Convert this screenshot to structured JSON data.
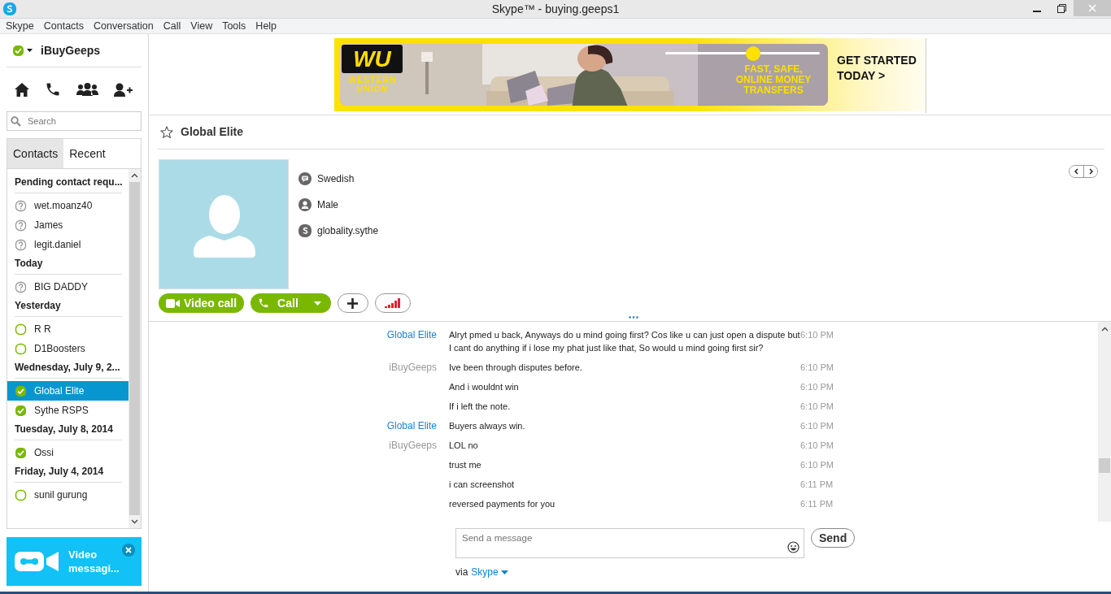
{
  "window": {
    "title": "Skype™ - buying.geeps1"
  },
  "menu": [
    "Skype",
    "Contacts",
    "Conversation",
    "Call",
    "View",
    "Tools",
    "Help"
  ],
  "profile": {
    "name": "iBuyGeeps",
    "kind": "online"
  },
  "search": {
    "placeholder": "Search"
  },
  "tabs": [
    {
      "label": "Contacts",
      "selected": true
    },
    {
      "label": "Recent",
      "selected": false
    }
  ],
  "contact_groups": [
    {
      "header": "Pending contact requ...",
      "contacts": [
        {
          "name": "wet.moanz40",
          "kind": "pending",
          "selected": false
        },
        {
          "name": "James",
          "kind": "pending",
          "selected": false
        },
        {
          "name": "legit.daniel",
          "kind": "pending",
          "selected": false
        }
      ]
    },
    {
      "header": "Today",
      "contacts": [
        {
          "name": "BIG DADDY",
          "kind": "pending",
          "selected": false
        }
      ]
    },
    {
      "header": "Yesterday",
      "contacts": [
        {
          "name": "R R",
          "kind": "offline",
          "selected": false
        },
        {
          "name": "D1Boosters",
          "kind": "offline",
          "selected": false
        }
      ]
    },
    {
      "header": "Wednesday, July 9, 2...",
      "contacts": [
        {
          "name": "Global Elite",
          "kind": "online",
          "selected": true
        },
        {
          "name": "Sythe RSPS",
          "kind": "online",
          "selected": false
        }
      ]
    },
    {
      "header": "Tuesday, July 8, 2014",
      "contacts": [
        {
          "name": "Ossi",
          "kind": "online",
          "selected": false
        }
      ]
    },
    {
      "header": "Friday, July 4, 2014",
      "contacts": [
        {
          "name": "sunil gurung",
          "kind": "offline",
          "selected": false
        }
      ]
    }
  ],
  "promo": {
    "text": "Video messagi..."
  },
  "ad": {
    "logo": "WU",
    "logo_caption": "WESTERN UNION",
    "tagline": "FAST, SAFE, ONLINE MONEY TRANSFERS",
    "cta": "GET STARTED TODAY >"
  },
  "conversation": {
    "title": "Global Elite",
    "details": [
      {
        "kind": "language",
        "text": "Swedish"
      },
      {
        "kind": "gender",
        "text": "Male"
      },
      {
        "kind": "skype",
        "text": "globality.sythe"
      }
    ],
    "video_call": "Video call",
    "call": "Call"
  },
  "messages": [
    {
      "sender": "Global Elite",
      "kind": "contact",
      "text": "Alryt pmed u back, Anyways do u mind going first? Cos like u can just open a dispute but I cant do anything if i lose my phat just like that, So would u mind going first sir?",
      "time": "6:10 PM"
    },
    {
      "sender": "iBuyGeeps",
      "kind": "self",
      "text": "Ive been through disputes before.",
      "time": "6:10 PM"
    },
    {
      "text": "And i wouldnt win",
      "time": "6:10 PM"
    },
    {
      "text": "If i left the note.",
      "time": "6:10 PM"
    },
    {
      "sender": "Global Elite",
      "kind": "contact",
      "text": "Buyers always win.",
      "time": "6:10 PM"
    },
    {
      "sender": "iBuyGeeps",
      "kind": "self",
      "text": "LOL no",
      "time": "6:10 PM"
    },
    {
      "text": "trust me",
      "time": "6:10 PM"
    },
    {
      "text": "i can screenshot",
      "time": "6:11 PM"
    },
    {
      "text": "reversed payments for you",
      "time": "6:11 PM"
    }
  ],
  "composer": {
    "placeholder": "Send a message",
    "send": "Send",
    "via": "via",
    "service": "Skype"
  }
}
